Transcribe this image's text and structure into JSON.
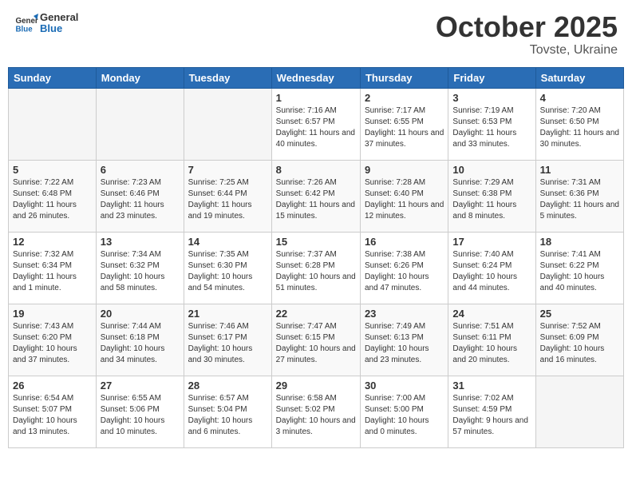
{
  "header": {
    "logo_general": "General",
    "logo_blue": "Blue",
    "month": "October 2025",
    "location": "Tovste, Ukraine"
  },
  "weekdays": [
    "Sunday",
    "Monday",
    "Tuesday",
    "Wednesday",
    "Thursday",
    "Friday",
    "Saturday"
  ],
  "weeks": [
    [
      {
        "day": "",
        "info": ""
      },
      {
        "day": "",
        "info": ""
      },
      {
        "day": "",
        "info": ""
      },
      {
        "day": "1",
        "info": "Sunrise: 7:16 AM\nSunset: 6:57 PM\nDaylight: 11 hours and 40 minutes."
      },
      {
        "day": "2",
        "info": "Sunrise: 7:17 AM\nSunset: 6:55 PM\nDaylight: 11 hours and 37 minutes."
      },
      {
        "day": "3",
        "info": "Sunrise: 7:19 AM\nSunset: 6:53 PM\nDaylight: 11 hours and 33 minutes."
      },
      {
        "day": "4",
        "info": "Sunrise: 7:20 AM\nSunset: 6:50 PM\nDaylight: 11 hours and 30 minutes."
      }
    ],
    [
      {
        "day": "5",
        "info": "Sunrise: 7:22 AM\nSunset: 6:48 PM\nDaylight: 11 hours and 26 minutes."
      },
      {
        "day": "6",
        "info": "Sunrise: 7:23 AM\nSunset: 6:46 PM\nDaylight: 11 hours and 23 minutes."
      },
      {
        "day": "7",
        "info": "Sunrise: 7:25 AM\nSunset: 6:44 PM\nDaylight: 11 hours and 19 minutes."
      },
      {
        "day": "8",
        "info": "Sunrise: 7:26 AM\nSunset: 6:42 PM\nDaylight: 11 hours and 15 minutes."
      },
      {
        "day": "9",
        "info": "Sunrise: 7:28 AM\nSunset: 6:40 PM\nDaylight: 11 hours and 12 minutes."
      },
      {
        "day": "10",
        "info": "Sunrise: 7:29 AM\nSunset: 6:38 PM\nDaylight: 11 hours and 8 minutes."
      },
      {
        "day": "11",
        "info": "Sunrise: 7:31 AM\nSunset: 6:36 PM\nDaylight: 11 hours and 5 minutes."
      }
    ],
    [
      {
        "day": "12",
        "info": "Sunrise: 7:32 AM\nSunset: 6:34 PM\nDaylight: 11 hours and 1 minute."
      },
      {
        "day": "13",
        "info": "Sunrise: 7:34 AM\nSunset: 6:32 PM\nDaylight: 10 hours and 58 minutes."
      },
      {
        "day": "14",
        "info": "Sunrise: 7:35 AM\nSunset: 6:30 PM\nDaylight: 10 hours and 54 minutes."
      },
      {
        "day": "15",
        "info": "Sunrise: 7:37 AM\nSunset: 6:28 PM\nDaylight: 10 hours and 51 minutes."
      },
      {
        "day": "16",
        "info": "Sunrise: 7:38 AM\nSunset: 6:26 PM\nDaylight: 10 hours and 47 minutes."
      },
      {
        "day": "17",
        "info": "Sunrise: 7:40 AM\nSunset: 6:24 PM\nDaylight: 10 hours and 44 minutes."
      },
      {
        "day": "18",
        "info": "Sunrise: 7:41 AM\nSunset: 6:22 PM\nDaylight: 10 hours and 40 minutes."
      }
    ],
    [
      {
        "day": "19",
        "info": "Sunrise: 7:43 AM\nSunset: 6:20 PM\nDaylight: 10 hours and 37 minutes."
      },
      {
        "day": "20",
        "info": "Sunrise: 7:44 AM\nSunset: 6:18 PM\nDaylight: 10 hours and 34 minutes."
      },
      {
        "day": "21",
        "info": "Sunrise: 7:46 AM\nSunset: 6:17 PM\nDaylight: 10 hours and 30 minutes."
      },
      {
        "day": "22",
        "info": "Sunrise: 7:47 AM\nSunset: 6:15 PM\nDaylight: 10 hours and 27 minutes."
      },
      {
        "day": "23",
        "info": "Sunrise: 7:49 AM\nSunset: 6:13 PM\nDaylight: 10 hours and 23 minutes."
      },
      {
        "day": "24",
        "info": "Sunrise: 7:51 AM\nSunset: 6:11 PM\nDaylight: 10 hours and 20 minutes."
      },
      {
        "day": "25",
        "info": "Sunrise: 7:52 AM\nSunset: 6:09 PM\nDaylight: 10 hours and 16 minutes."
      }
    ],
    [
      {
        "day": "26",
        "info": "Sunrise: 6:54 AM\nSunset: 5:07 PM\nDaylight: 10 hours and 13 minutes."
      },
      {
        "day": "27",
        "info": "Sunrise: 6:55 AM\nSunset: 5:06 PM\nDaylight: 10 hours and 10 minutes."
      },
      {
        "day": "28",
        "info": "Sunrise: 6:57 AM\nSunset: 5:04 PM\nDaylight: 10 hours and 6 minutes."
      },
      {
        "day": "29",
        "info": "Sunrise: 6:58 AM\nSunset: 5:02 PM\nDaylight: 10 hours and 3 minutes."
      },
      {
        "day": "30",
        "info": "Sunrise: 7:00 AM\nSunset: 5:00 PM\nDaylight: 10 hours and 0 minutes."
      },
      {
        "day": "31",
        "info": "Sunrise: 7:02 AM\nSunset: 4:59 PM\nDaylight: 9 hours and 57 minutes."
      },
      {
        "day": "",
        "info": ""
      }
    ]
  ]
}
